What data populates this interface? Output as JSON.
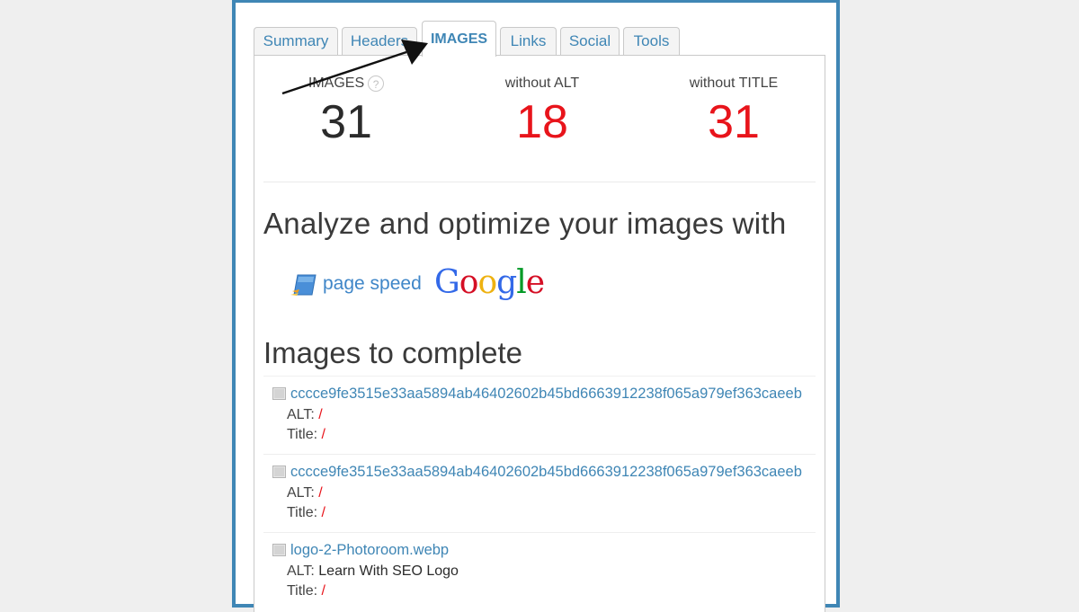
{
  "tabs": [
    {
      "label": "Summary",
      "active": false
    },
    {
      "label": "Headers",
      "active": false
    },
    {
      "label": "IMAGES",
      "active": true
    },
    {
      "label": "Links",
      "active": false
    },
    {
      "label": "Social",
      "active": false
    },
    {
      "label": "Tools",
      "active": false
    }
  ],
  "stats": {
    "images": {
      "label": "IMAGES",
      "value": "31",
      "help_icon": "?"
    },
    "without_alt": {
      "label": "without ALT",
      "value": "18"
    },
    "without_title": {
      "label": "without TITLE",
      "value": "31"
    }
  },
  "analyze_heading": "Analyze and optimize your images with",
  "pagespeed_label": "page speed",
  "google_logo": [
    "G",
    "o",
    "o",
    "g",
    "l",
    "e"
  ],
  "complete_heading": "Images to complete",
  "images": [
    {
      "name": "cccce9fe3515e33aa5894ab46402602b45bd6663912238f065a979ef363caeeb",
      "alt_label": "ALT:",
      "alt": "/",
      "title_label": "Title:",
      "title": "/"
    },
    {
      "name": "cccce9fe3515e33aa5894ab46402602b45bd6663912238f065a979ef363caeeb",
      "alt_label": "ALT:",
      "alt": "/",
      "title_label": "Title:",
      "title": "/"
    },
    {
      "name": "logo-2-Photoroom.webp",
      "alt_label": "ALT:",
      "alt": "Learn With SEO Logo",
      "title_label": "Title:",
      "title": "/"
    }
  ],
  "colors": {
    "accent": "#3f86b5",
    "warning": "#e8141b",
    "google": [
      "#3369e8",
      "#d50f25",
      "#eeb211",
      "#3369e8",
      "#009925",
      "#d50f25"
    ]
  }
}
